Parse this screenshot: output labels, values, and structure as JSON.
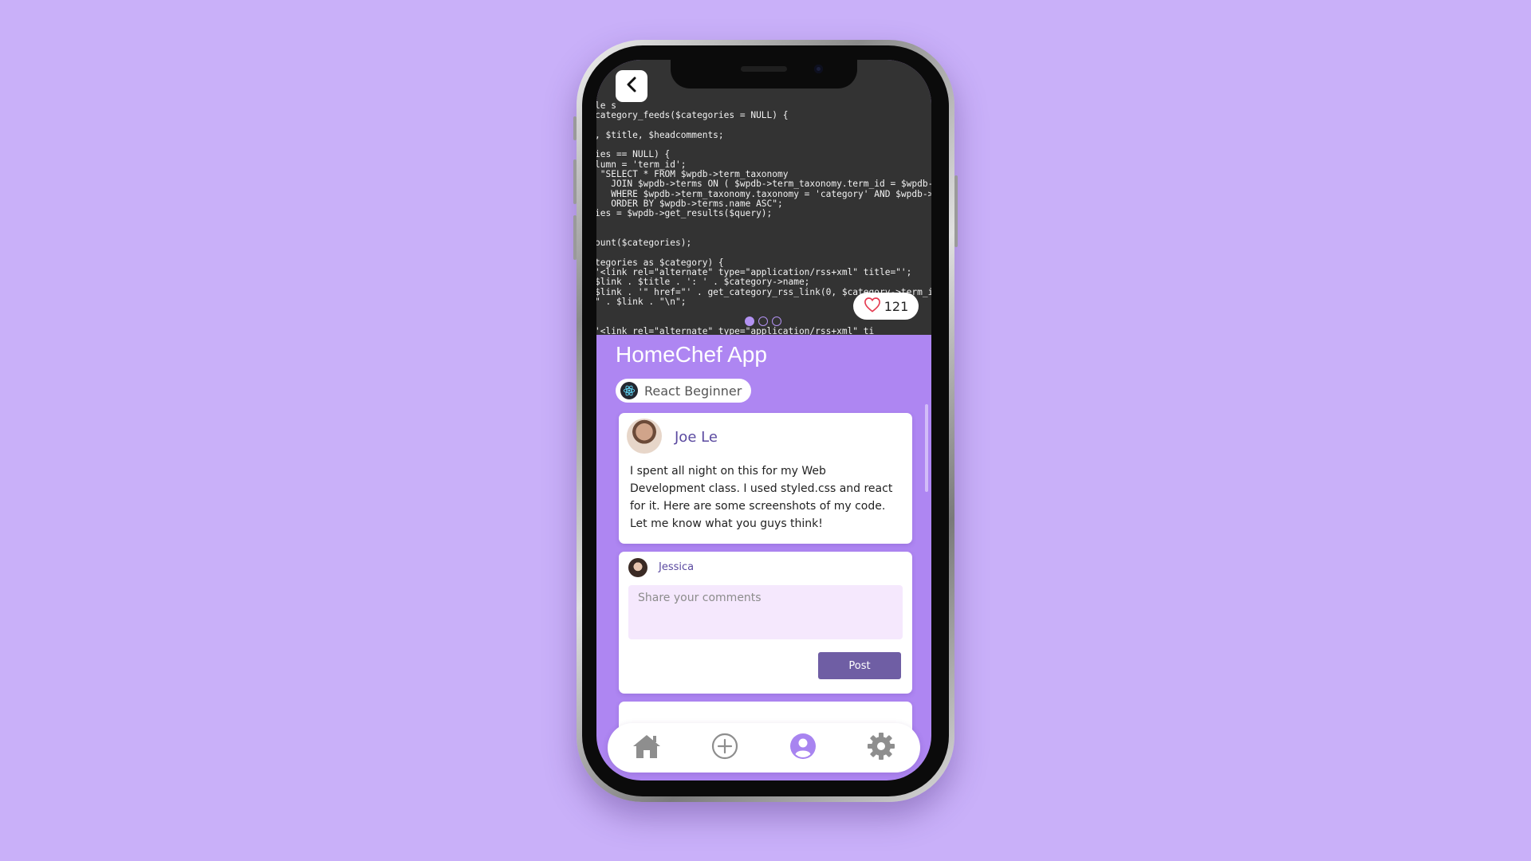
{
  "hero": {
    "code_lines": [
      "le s",
      "category_feeds($categories = NULL) {",
      "",
      ", $title, $headcomments;",
      "",
      "ies == NULL) {",
      "lumn = 'term_id';",
      " \"SELECT * FROM $wpdb->term_taxonomy",
      "   JOIN $wpdb->terms ON ( $wpdb->term_taxonomy.term_id = $wpdb->terms",
      "   WHERE $wpdb->term_taxonomy.taxonomy = 'category' AND $wpdb->terms",
      "   ORDER BY $wpdb->terms.name ASC\";",
      "ies = $wpdb->get_results($query);",
      "",
      "",
      "ount($categories);",
      "",
      "tegories as $category) {",
      "'<link rel=\"alternate\" type=\"application/rss+xml\" title=\"';",
      "$link . $title . ': ' . $category->name;",
      "$link . '\" href=\"' . get_category_rss_link(0, $category->term_id, $",
      "\" . $link . \"\\n\";",
      "",
      "",
      "'<link rel=\"alternate\" type=\"application/rss+xml\" ti"
    ],
    "like_count": "121",
    "carousel_total": 3,
    "carousel_active": 0
  },
  "project": {
    "title": "HomeChef App",
    "tag_label": "React Beginner"
  },
  "post": {
    "author": "Joe Le",
    "body": "I spent all night on this for my Web Development class. I used styled.css and react for it. Here are some screenshots of my code. Let me know what you guys think!"
  },
  "comment_form": {
    "user": "Jessica",
    "placeholder": "Share your comments",
    "value": "",
    "submit_label": "Post"
  },
  "tabbar": {
    "items": [
      "home-icon",
      "add-circle-icon",
      "profile-icon",
      "settings-gear-icon"
    ],
    "active": "profile-icon"
  },
  "colors": {
    "background": "#c9b0f9",
    "screen": "#ae86f2",
    "accent": "#a884f0",
    "button": "#6f5ea4",
    "input_bg": "#f5e8fd",
    "text_name": "#5b4aa0"
  }
}
